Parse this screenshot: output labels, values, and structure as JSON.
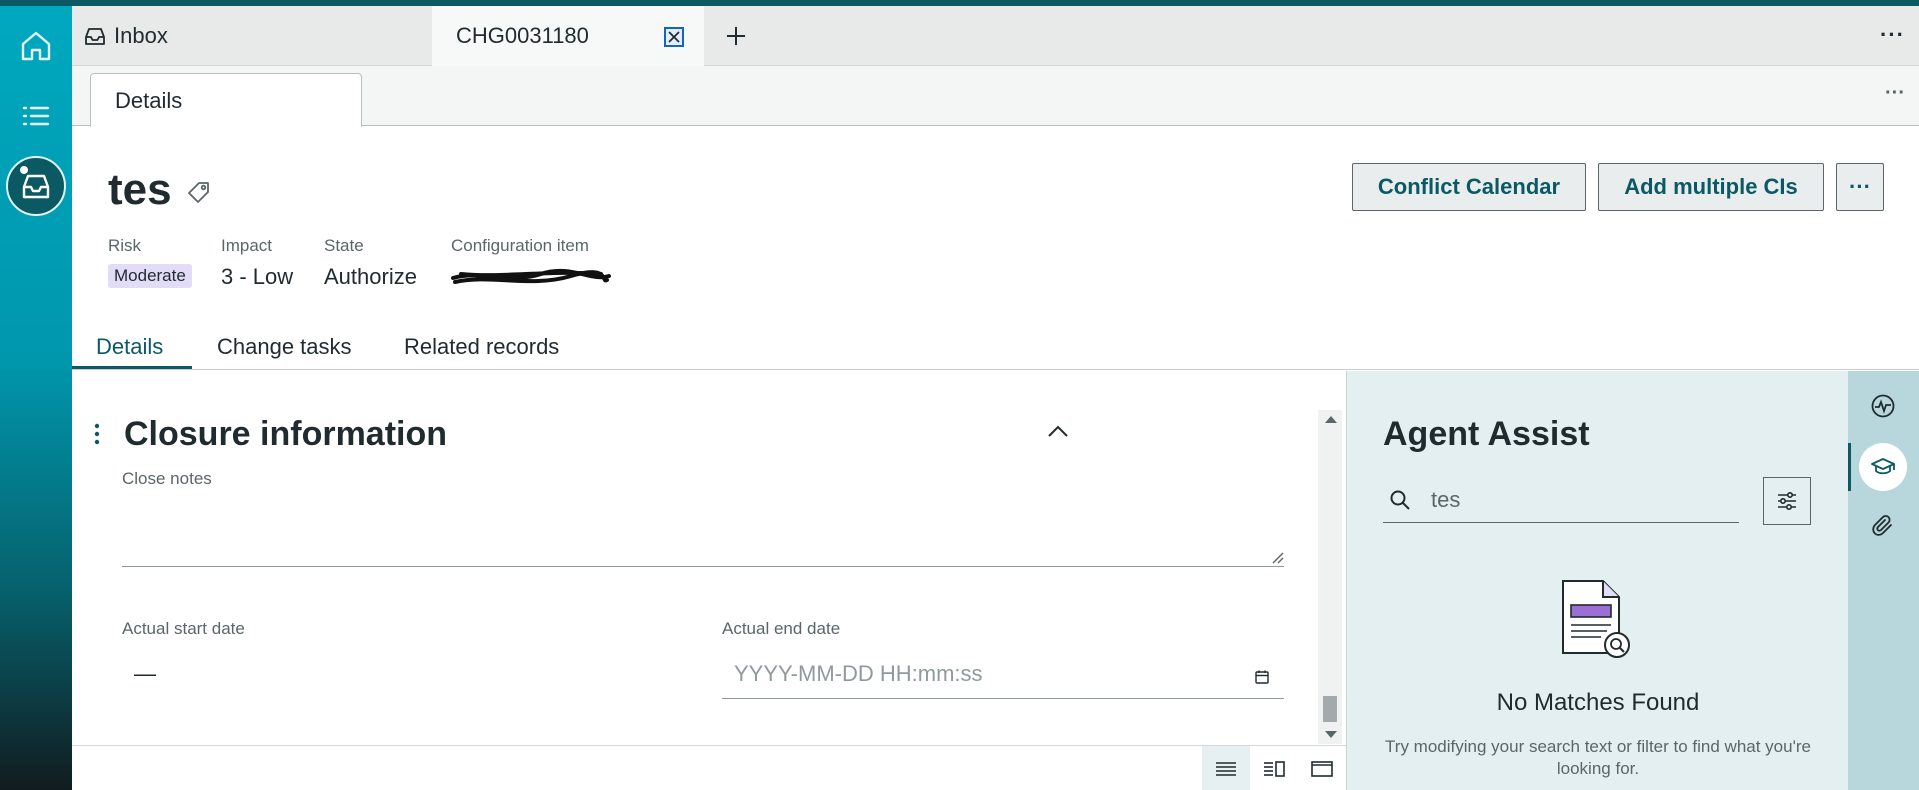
{
  "tabs": {
    "inbox_label": "Inbox",
    "record_label": "CHG0031180"
  },
  "subtabs": {
    "details_label": "Details"
  },
  "record": {
    "title": "tes",
    "risk_label": "Risk",
    "risk_value": "Moderate",
    "impact_label": "Impact",
    "impact_value": "3 - Low",
    "state_label": "State",
    "state_value": "Authorize",
    "ci_label": "Configuration item"
  },
  "actions": {
    "conflict_calendar": "Conflict Calendar",
    "add_multiple_cis": "Add multiple CIs",
    "more": "···"
  },
  "content_tabs": {
    "details": "Details",
    "change_tasks": "Change tasks",
    "related_records": "Related records"
  },
  "section": {
    "title": "Closure information",
    "close_notes_label": "Close notes",
    "actual_start_label": "Actual start date",
    "actual_start_value": "—",
    "actual_end_label": "Actual end date",
    "actual_end_placeholder": "YYYY-MM-DD HH:mm:ss"
  },
  "assist": {
    "title": "Agent Assist",
    "search_value": "tes",
    "empty_title": "No Matches Found",
    "empty_sub": "Try modifying your search text or filter to find what you're looking for."
  },
  "colors": {
    "brand_teal": "#0b5a63",
    "rail_gradient_top": "#00a8bf",
    "risk_badge": "#e2dcf7",
    "assist_bg": "#e3eff0"
  },
  "icons": [
    "home-icon",
    "list-icon",
    "inbox-icon",
    "close-icon",
    "plus-icon",
    "tag-icon",
    "chevron-up-icon",
    "calendar-icon",
    "search-icon",
    "filter-icon",
    "pulse-icon",
    "graduation-cap-icon",
    "paperclip-icon"
  ]
}
